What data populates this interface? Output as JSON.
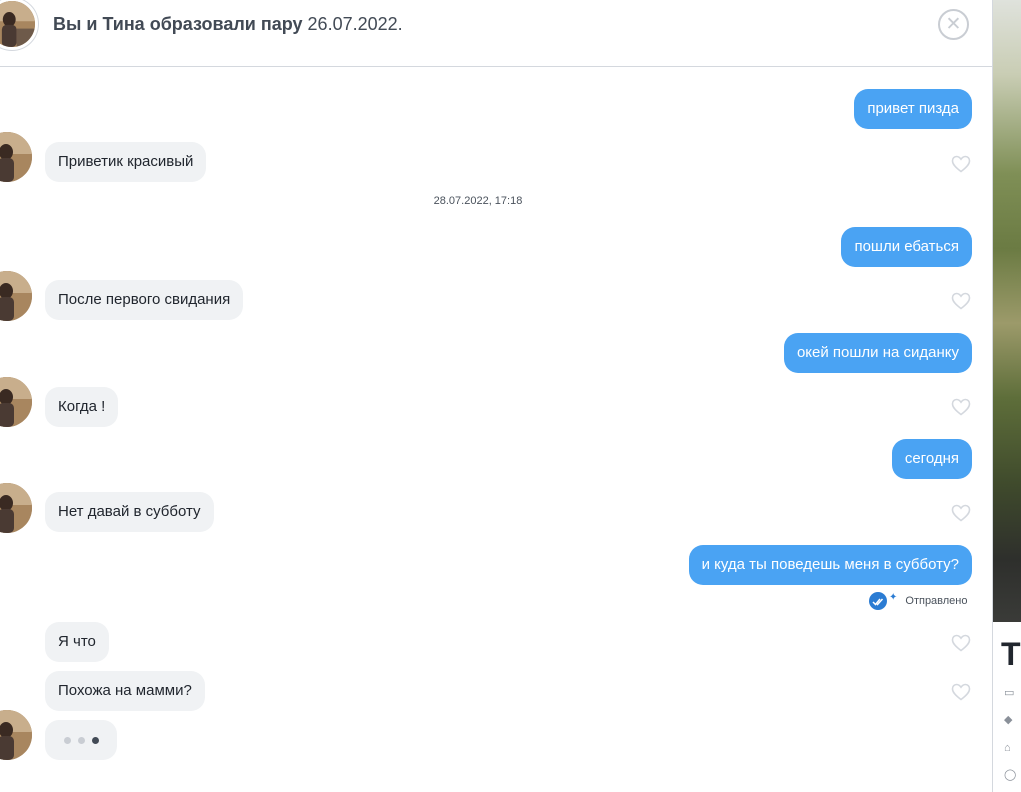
{
  "header": {
    "title": "Вы и Тина образовали пару",
    "match_date": "26.07.2022.",
    "close_icon": "close-icon"
  },
  "messages": [
    {
      "direction": "out",
      "text": "привет пизда"
    },
    {
      "direction": "in",
      "text": "Приветик красивый"
    },
    {
      "direction": "out",
      "text": "пошли ебаться"
    },
    {
      "direction": "in",
      "text": "После первого свидания"
    },
    {
      "direction": "out",
      "text": "окей пошли на сиданку"
    },
    {
      "direction": "in",
      "text": "Когда !"
    },
    {
      "direction": "out",
      "text": "сегодня"
    },
    {
      "direction": "in",
      "text": "Нет давай в субботу"
    },
    {
      "direction": "out",
      "text": "и куда ты поведешь меня в субботу?"
    },
    {
      "direction": "in",
      "text": "Я что"
    },
    {
      "direction": "in",
      "text": "Похожа на мамми?"
    }
  ],
  "timestamp": "28.07.2022, 17:18",
  "status": {
    "text": "Отправлено",
    "icon": "double-check-icon"
  },
  "typing_indicator": {
    "dots": 3,
    "active_dot": 3
  },
  "profile": {
    "name_initial": "Т",
    "icons": [
      "briefcase-icon",
      "graduation-cap-icon",
      "home-icon",
      "person-icon"
    ]
  },
  "colors": {
    "outgoing_bubble": "#4aa3f3",
    "incoming_bubble": "#f0f2f4",
    "accent": "#2b7cd3"
  }
}
